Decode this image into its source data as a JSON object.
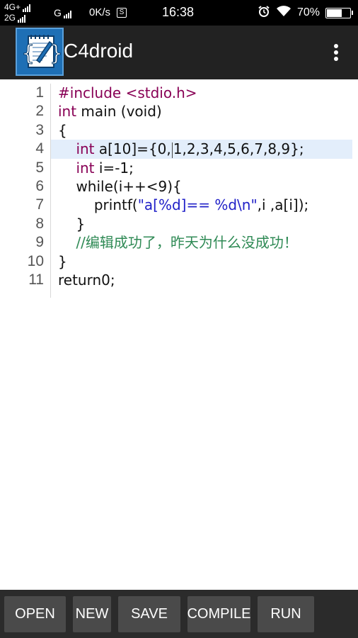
{
  "status_bar": {
    "network_top": "4G+",
    "network_bottom": "2G",
    "network_g": "G",
    "speed": "0K/s",
    "speed_badge": "S",
    "time": "16:38",
    "battery": "70%",
    "battery_level": 0.7,
    "icons": [
      "alarm-icon",
      "wifi-icon",
      "battery-icon"
    ]
  },
  "app": {
    "title": "C4droid",
    "logo_icon": "c4droid-logo-icon",
    "menu_icon": "overflow-menu-icon"
  },
  "editor": {
    "line_numbers": [
      "1",
      "2",
      "3",
      "4",
      "5",
      "6",
      "7",
      "8",
      "9",
      "10",
      "11"
    ],
    "highlighted_line": 4,
    "lines": [
      {
        "indent": "",
        "segments": [
          {
            "t": "#include <stdio.h>",
            "c": "kw"
          }
        ]
      },
      {
        "indent": "",
        "segments": [
          {
            "t": "int",
            "c": "kw"
          },
          {
            "t": " main (void)",
            "c": ""
          }
        ]
      },
      {
        "indent": "",
        "segments": [
          {
            "t": "{",
            "c": ""
          }
        ]
      },
      {
        "indent": "    ",
        "segments": [
          {
            "t": "int",
            "c": "kw"
          },
          {
            "t": " a[10]={0,",
            "c": ""
          },
          {
            "t": "",
            "c": "cursor"
          },
          {
            "t": "1,2,3,4,5,6,7,8,9};",
            "c": ""
          }
        ]
      },
      {
        "indent": "    ",
        "segments": [
          {
            "t": "int",
            "c": "kw"
          },
          {
            "t": " i=-1;",
            "c": ""
          }
        ]
      },
      {
        "indent": "    ",
        "segments": [
          {
            "t": "while(i++<9){",
            "c": ""
          }
        ]
      },
      {
        "indent": "        ",
        "segments": [
          {
            "t": "printf(",
            "c": ""
          },
          {
            "t": "\"a[%d]== %d\\n\"",
            "c": "str"
          },
          {
            "t": ",i ,a[i]);",
            "c": ""
          }
        ]
      },
      {
        "indent": "    ",
        "segments": [
          {
            "t": "}",
            "c": ""
          }
        ]
      },
      {
        "indent": "    ",
        "segments": [
          {
            "t": "//编辑成功了，昨天为什么没成功！",
            "c": "cmt"
          }
        ]
      },
      {
        "indent": "",
        "segments": [
          {
            "t": "}",
            "c": ""
          }
        ]
      },
      {
        "indent": "",
        "segments": [
          {
            "t": "return0;",
            "c": ""
          }
        ]
      }
    ]
  },
  "toolbar": {
    "buttons": [
      {
        "label": "OPEN"
      },
      {
        "label": "NEW"
      },
      {
        "label": "SAVE"
      },
      {
        "label": "COMPILE"
      },
      {
        "label": "RUN"
      }
    ]
  },
  "colors": {
    "app_bar": "#222222",
    "keyword": "#880055",
    "string": "#2121c8",
    "comment": "#2f8a55",
    "highlight": "#e3eefb",
    "button": "#4a4a4a"
  }
}
